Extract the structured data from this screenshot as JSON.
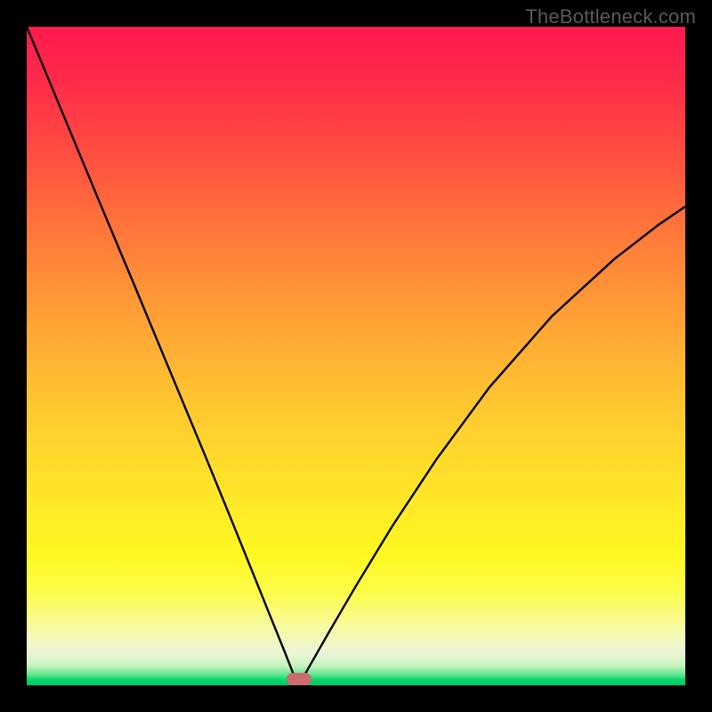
{
  "watermark": "TheBottleneck.com",
  "marker": {
    "x_frac": 0.413,
    "y_frac": 0.991,
    "color": "#cc6b6b"
  },
  "chart_data": {
    "type": "line",
    "title": "",
    "xlabel": "",
    "ylabel": "",
    "xlim": [
      0,
      1
    ],
    "ylim": [
      0,
      1
    ],
    "series": [
      {
        "name": "left-branch",
        "x": [
          0.0,
          0.054,
          0.108,
          0.162,
          0.216,
          0.27,
          0.311,
          0.338,
          0.365,
          0.392,
          0.405,
          0.413
        ],
        "y": [
          1.0,
          0.87,
          0.74,
          0.611,
          0.481,
          0.351,
          0.251,
          0.184,
          0.117,
          0.05,
          0.017,
          0.0
        ]
      },
      {
        "name": "right-branch",
        "x": [
          0.413,
          0.43,
          0.459,
          0.5,
          0.554,
          0.622,
          0.703,
          0.797,
          0.892,
          0.959,
          1.0
        ],
        "y": [
          0.0,
          0.03,
          0.081,
          0.151,
          0.24,
          0.343,
          0.453,
          0.56,
          0.647,
          0.699,
          0.727
        ]
      }
    ],
    "gradient_stops": [
      {
        "pos": 0.0,
        "color": "#ff1a4d"
      },
      {
        "pos": 0.2,
        "color": "#ff5040"
      },
      {
        "pos": 0.42,
        "color": "#ff9a36"
      },
      {
        "pos": 0.62,
        "color": "#ffd22e"
      },
      {
        "pos": 0.8,
        "color": "#fff820"
      },
      {
        "pos": 0.95,
        "color": "#ecf6d8"
      },
      {
        "pos": 1.0,
        "color": "#00c864"
      }
    ]
  }
}
